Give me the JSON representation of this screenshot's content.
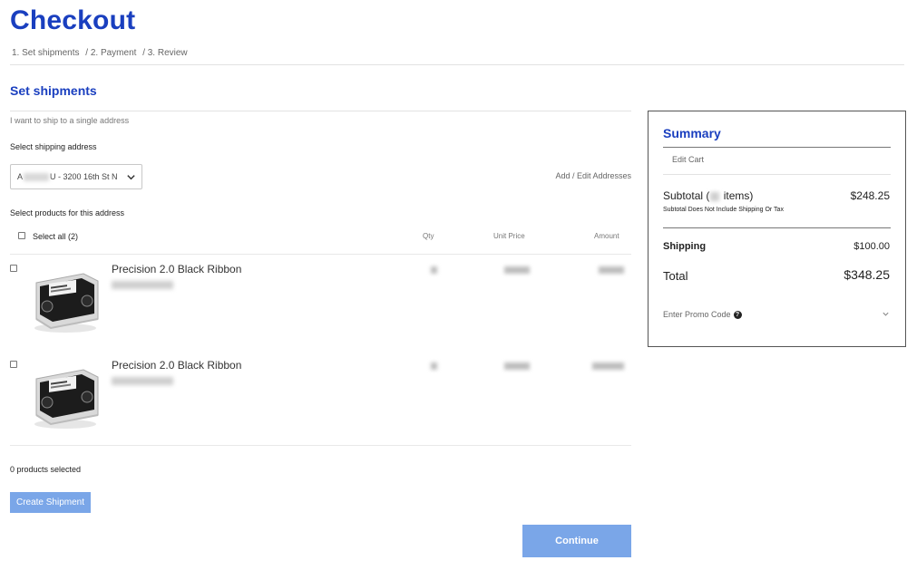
{
  "header": {
    "title": "Checkout",
    "breadcrumb": [
      "1. Set shipments",
      "/ 2. Payment",
      "/ 3. Review"
    ]
  },
  "shipments": {
    "title": "Set shipments",
    "single_address_link": "I want to ship to a single address",
    "select_address_label": "Select shipping address",
    "address_prefix": "A",
    "address_suffix": "U - 3200 16th St N",
    "add_edit_link": "Add / Edit Addresses",
    "select_products_label": "Select products for this address",
    "select_all_label": "Select all (2)",
    "columns": {
      "qty": "Qty",
      "unit_price": "Unit Price",
      "amount": "Amount"
    },
    "products": [
      {
        "name": "Precision 2.0 Black Ribbon"
      },
      {
        "name": "Precision 2.0 Black Ribbon"
      }
    ],
    "selected_count": "0 products selected",
    "create_shipment_label": "Create Shipment",
    "continue_label": "Continue"
  },
  "summary": {
    "title": "Summary",
    "edit_cart": "Edit Cart",
    "subtotal_prefix": "Subtotal (",
    "subtotal_suffix": " items)",
    "subtotal_value": "$248.25",
    "subtotal_note": "Subtotal Does Not Include Shipping Or Tax",
    "shipping_label": "Shipping",
    "shipping_value": "$100.00",
    "total_label": "Total",
    "total_value": "$348.25",
    "promo_label": "Enter Promo Code",
    "promo_help": "?"
  },
  "colors": {
    "accent": "#1a3fbf",
    "button": "#7aa6e8"
  },
  "icons": [
    "chevron-down-icon",
    "help-icon",
    "product-thumbnail"
  ]
}
